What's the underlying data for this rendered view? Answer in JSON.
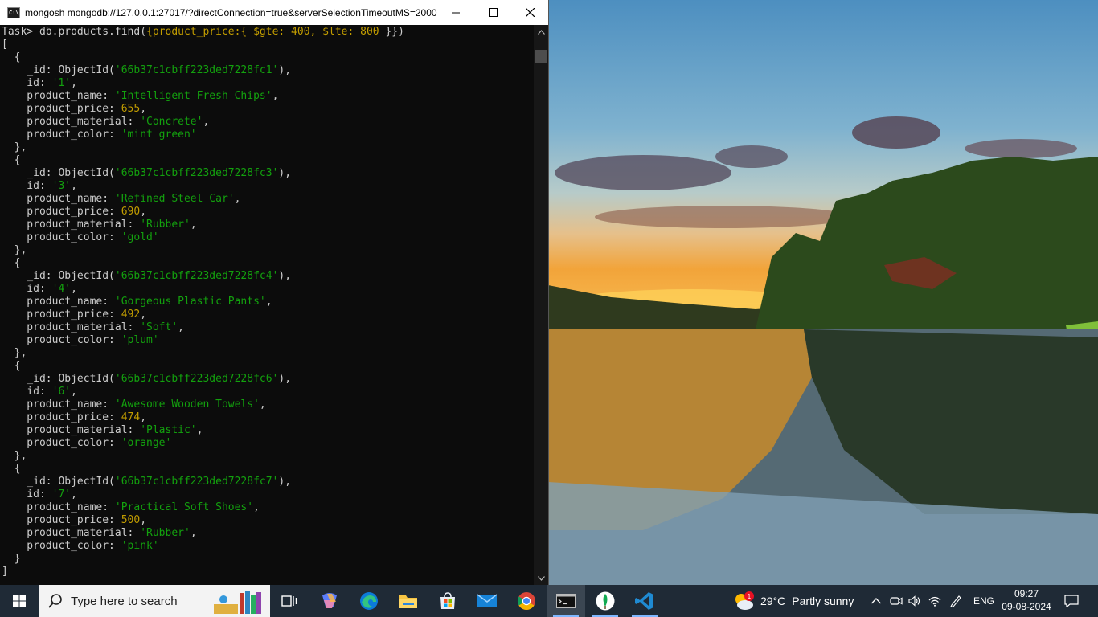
{
  "window": {
    "title": "mongosh mongodb://127.0.0.1:27017/?directConnection=true&serverSelectionTimeoutMS=2000",
    "icon_label": "C:\\."
  },
  "terminal": {
    "prompt": "Task> ",
    "command": "db.products.find({product_price:{ $gte: 400, $lte: 800 }})",
    "results": [
      {
        "_id": "66b37c1cbff223ded7228fc1",
        "id": "1",
        "product_name": "Intelligent Fresh Chips",
        "product_price": "655",
        "product_material": "Concrete",
        "product_color": "mint green"
      },
      {
        "_id": "66b37c1cbff223ded7228fc3",
        "id": "3",
        "product_name": "Refined Steel Car",
        "product_price": "690",
        "product_material": "Rubber",
        "product_color": "gold"
      },
      {
        "_id": "66b37c1cbff223ded7228fc4",
        "id": "4",
        "product_name": "Gorgeous Plastic Pants",
        "product_price": "492",
        "product_material": "Soft",
        "product_color": "plum"
      },
      {
        "_id": "66b37c1cbff223ded7228fc6",
        "id": "6",
        "product_name": "Awesome Wooden Towels",
        "product_price": "474",
        "product_material": "Plastic",
        "product_color": "orange"
      },
      {
        "_id": "66b37c1cbff223ded7228fc7",
        "id": "7",
        "product_name": "Practical Soft Shoes",
        "product_price": "500",
        "product_material": "Rubber",
        "product_color": "pink"
      }
    ]
  },
  "taskbar": {
    "search_placeholder": "Type here to search",
    "apps": [
      "task-view",
      "copilot",
      "edge",
      "file-explorer",
      "microsoft-store",
      "mail",
      "chrome",
      "command-prompt",
      "mongodb-compass",
      "vscode"
    ],
    "weather": {
      "temp": "29°C",
      "condition": "Partly sunny",
      "badge": "1"
    },
    "language": "ENG",
    "time": "09:27",
    "date": "09-08-2024"
  },
  "colors": {
    "string": "#13a10e",
    "number": "#c19c00",
    "taskbar": "#1f2a36"
  }
}
